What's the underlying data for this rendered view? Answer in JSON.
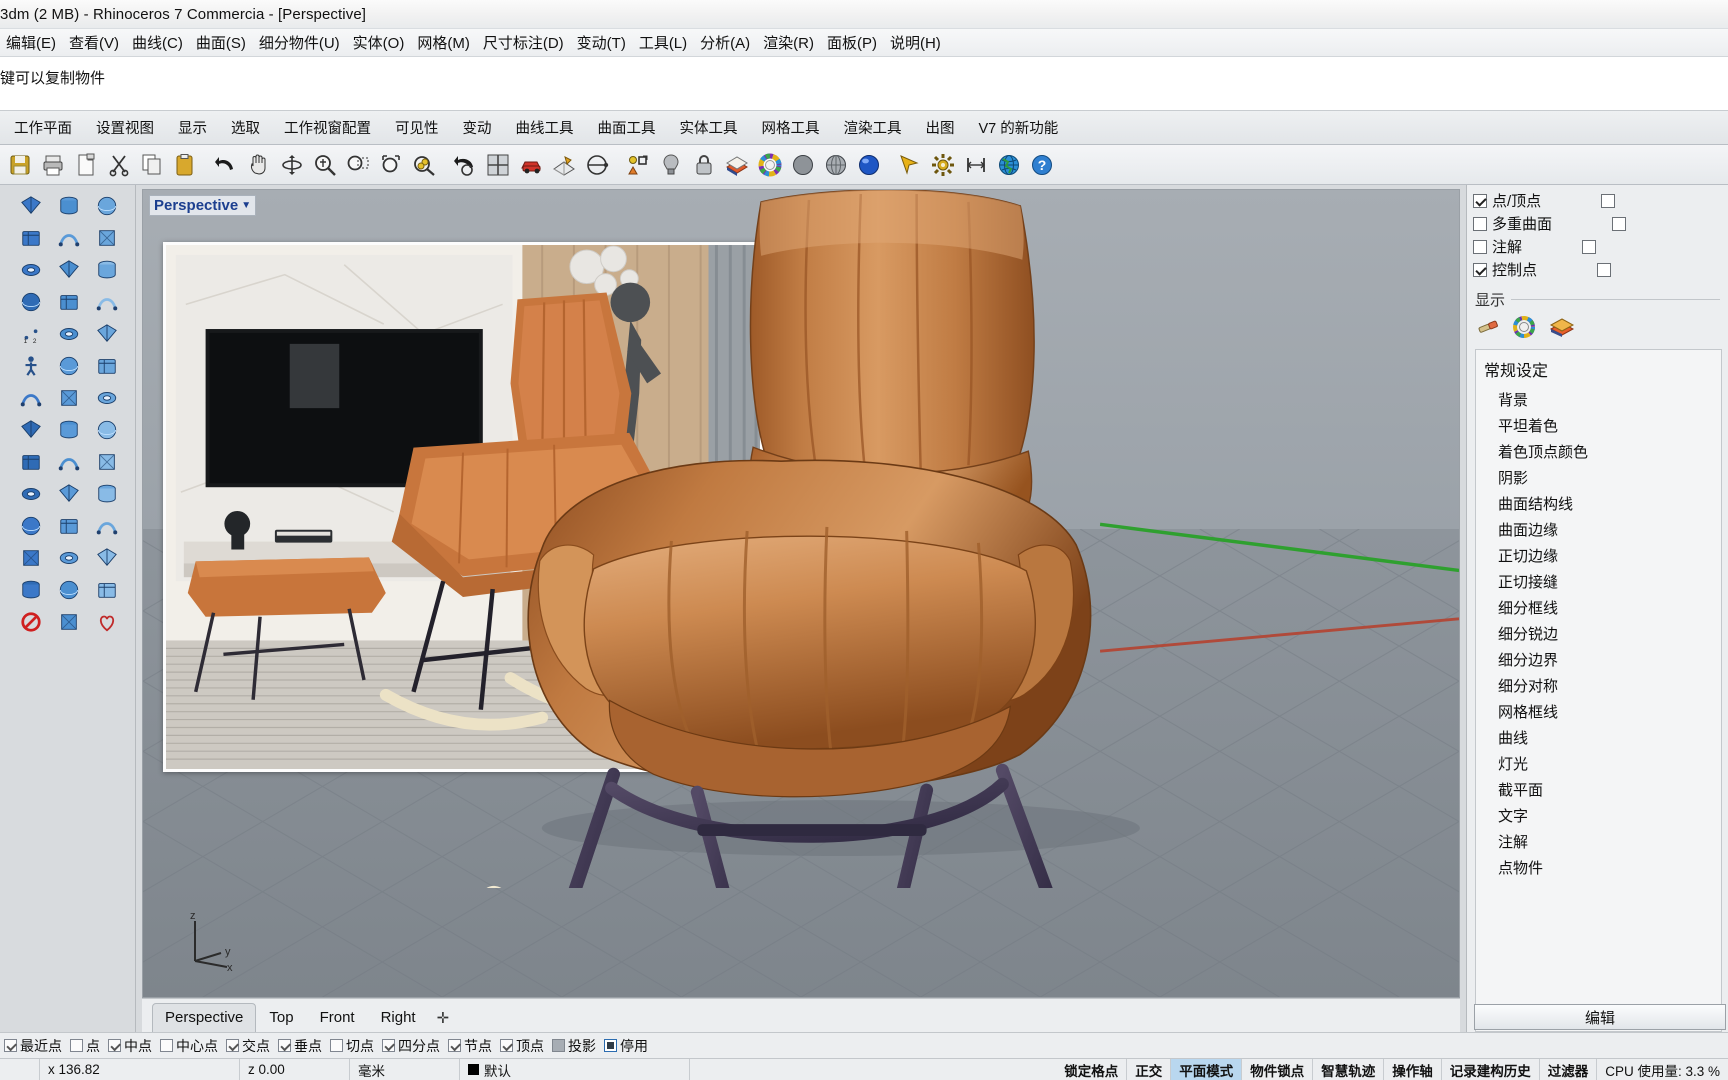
{
  "window": {
    "title": "3dm (2 MB) - Rhinoceros 7 Commercia - [Perspective]"
  },
  "menubar": {
    "items": [
      {
        "label": "编辑(E)"
      },
      {
        "label": "查看(V)"
      },
      {
        "label": "曲线(C)"
      },
      {
        "label": "曲面(S)"
      },
      {
        "label": "细分物件(U)"
      },
      {
        "label": "实体(O)"
      },
      {
        "label": "网格(M)"
      },
      {
        "label": "尺寸标注(D)"
      },
      {
        "label": "变动(T)"
      },
      {
        "label": "工具(L)"
      },
      {
        "label": "分析(A)"
      },
      {
        "label": "渲染(R)"
      },
      {
        "label": "面板(P)"
      },
      {
        "label": "说明(H)"
      }
    ]
  },
  "command": {
    "history": "键可以复制物件",
    "placeholder": ""
  },
  "tabbar": {
    "tabs": [
      {
        "label": "工作平面"
      },
      {
        "label": "设置视图"
      },
      {
        "label": "显示"
      },
      {
        "label": "选取"
      },
      {
        "label": "工作视窗配置"
      },
      {
        "label": "可见性"
      },
      {
        "label": "变动"
      },
      {
        "label": "曲线工具"
      },
      {
        "label": "曲面工具"
      },
      {
        "label": "实体工具"
      },
      {
        "label": "网格工具"
      },
      {
        "label": "渲染工具"
      },
      {
        "label": "出图"
      },
      {
        "label": "V7 的新功能"
      }
    ]
  },
  "toolbar": {
    "icons": [
      {
        "name": "save-icon"
      },
      {
        "name": "print-icon"
      },
      {
        "name": "new-file-icon"
      },
      {
        "name": "cut-icon"
      },
      {
        "name": "copy-icon"
      },
      {
        "name": "paste-icon"
      },
      {
        "name": "undo-icon"
      },
      {
        "name": "pan-icon"
      },
      {
        "name": "rotate-view-icon"
      },
      {
        "name": "zoom-dynamic-icon"
      },
      {
        "name": "zoom-window-icon"
      },
      {
        "name": "zoom-extents-icon"
      },
      {
        "name": "zoom-selected-icon"
      },
      {
        "name": "undo-view-icon"
      },
      {
        "name": "four-view-icon"
      },
      {
        "name": "render-preview-icon"
      },
      {
        "name": "render-mesh-icon"
      },
      {
        "name": "plan-view-icon"
      },
      {
        "name": "object-properties-icon"
      },
      {
        "name": "light-bulb-icon"
      },
      {
        "name": "lock-icon"
      },
      {
        "name": "layer-icon"
      },
      {
        "name": "color-wheel-icon"
      },
      {
        "name": "shaded-sphere-icon"
      },
      {
        "name": "ghosted-sphere-icon"
      },
      {
        "name": "rendered-sphere-icon"
      },
      {
        "name": "select-arrow-icon"
      },
      {
        "name": "options-gear-icon"
      },
      {
        "name": "dimension-icon"
      },
      {
        "name": "globe-icon"
      },
      {
        "name": "help-icon"
      }
    ]
  },
  "viewport": {
    "label": "Perspective",
    "dropdown_icon": "chevron-down-icon",
    "axis_gizmo": {
      "z": "z",
      "y": "y",
      "x": "x"
    },
    "tabs": [
      {
        "label": "Perspective",
        "active": true
      },
      {
        "label": "Top",
        "active": false
      },
      {
        "label": "Front",
        "active": false
      },
      {
        "label": "Right",
        "active": false
      }
    ],
    "add_tab_icon": "add-viewport-icon"
  },
  "right_panel": {
    "filters": [
      {
        "label": "点/顶点",
        "checked": true
      },
      {
        "label": "多重曲面",
        "checked": false
      },
      {
        "label": "注解",
        "checked": false
      },
      {
        "label": "控制点",
        "checked": true
      }
    ],
    "display_section": {
      "title": "显示",
      "icons": [
        {
          "name": "paintbrush-icon"
        },
        {
          "name": "color-wheel-icon"
        },
        {
          "name": "layer-stack-icon"
        }
      ]
    },
    "settings_list": {
      "title": "常规设定",
      "items": [
        {
          "label": "背景"
        },
        {
          "label": "平坦着色"
        },
        {
          "label": "着色顶点颜色"
        },
        {
          "label": "阴影"
        },
        {
          "label": "曲面结构线"
        },
        {
          "label": "曲面边缘"
        },
        {
          "label": "正切边缘"
        },
        {
          "label": "正切接缝"
        },
        {
          "label": "细分框线"
        },
        {
          "label": "细分锐边"
        },
        {
          "label": "细分边界"
        },
        {
          "label": "细分对称"
        },
        {
          "label": "网格框线"
        },
        {
          "label": "曲线"
        },
        {
          "label": "灯光"
        },
        {
          "label": "截平面"
        },
        {
          "label": "文字"
        },
        {
          "label": "注解"
        },
        {
          "label": "点物件"
        }
      ]
    },
    "edit_button": "编辑"
  },
  "osnap": {
    "items": [
      {
        "label": "最近点",
        "state": "checked"
      },
      {
        "label": "点",
        "state": "unchecked"
      },
      {
        "label": "中点",
        "state": "checked"
      },
      {
        "label": "中心点",
        "state": "unchecked"
      },
      {
        "label": "交点",
        "state": "checked"
      },
      {
        "label": "垂点",
        "state": "checked"
      },
      {
        "label": "切点",
        "state": "unchecked"
      },
      {
        "label": "四分点",
        "state": "checked"
      },
      {
        "label": "节点",
        "state": "checked"
      },
      {
        "label": "顶点",
        "state": "checked"
      },
      {
        "label": "投影",
        "state": "solid"
      },
      {
        "label": "停用",
        "state": "framed"
      }
    ]
  },
  "statusbar": {
    "coord_x": "x 136.82",
    "coord_z": "z 0.00",
    "units": "毫米",
    "layer": "默认",
    "layer_color": "#000000",
    "toggles": [
      {
        "label": "锁定格点",
        "active": false
      },
      {
        "label": "正交",
        "active": false
      },
      {
        "label": "平面模式",
        "active": true
      },
      {
        "label": "物件锁点",
        "active": false
      },
      {
        "label": "智慧轨迹",
        "active": false
      },
      {
        "label": "操作轴",
        "active": false
      },
      {
        "label": "记录建构历史",
        "active": false
      },
      {
        "label": "过滤器",
        "active": false
      }
    ],
    "cpu": "CPU 使用量: 3.3 %"
  },
  "colors": {
    "accent": "#1c3f8f",
    "highlight": "#b9d7ef",
    "leather": "#c2763c",
    "leather_dark": "#8d4d22",
    "frame": "#413a52",
    "runner": "#e6dcc0",
    "viewport_sky": "#a7adb3",
    "viewport_ground": "#878e95",
    "axis_green": "#2fa02f",
    "axis_red": "#b04a3a"
  }
}
